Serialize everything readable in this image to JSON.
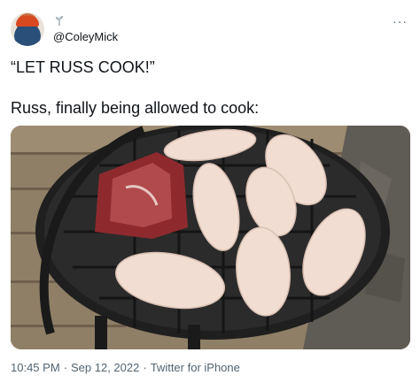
{
  "author": {
    "handle": "@ColeyMick"
  },
  "icons": {
    "avatar": "profile-photo",
    "sprout": "sprout-icon",
    "more": "more-options-icon"
  },
  "more_label": "···",
  "tweet": {
    "line1": "“LET RUSS COOK!”",
    "line2": "Russ, finally being allowed to cook:"
  },
  "meta": {
    "time": "10:45 PM",
    "date": "Sep 12, 2022",
    "app": "Twitter for iPhone",
    "separator": "·"
  },
  "colors": {
    "text": "#0f1419",
    "secondary": "#536471"
  }
}
